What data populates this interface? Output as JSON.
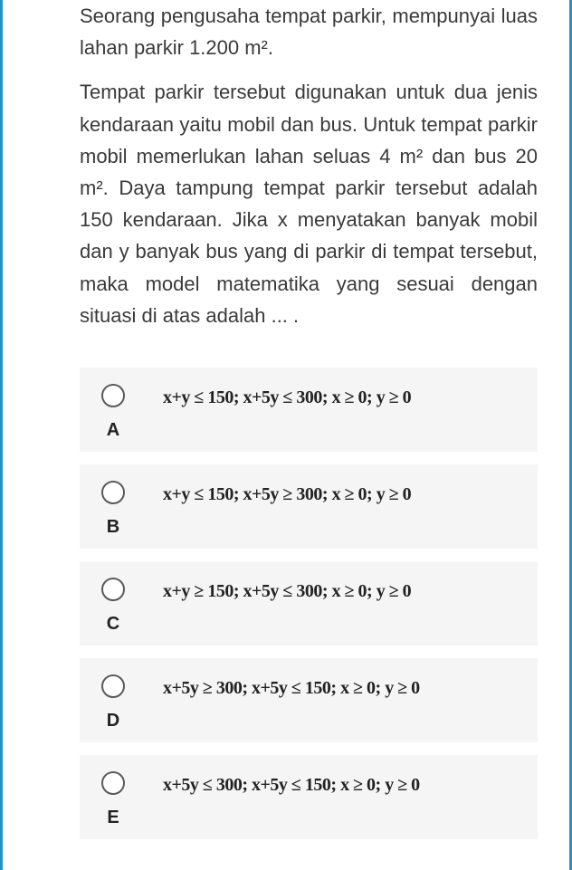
{
  "question": {
    "paragraph1": "Seorang pengusaha tempat parkir, mempunyai luas lahan parkir 1.200 m².",
    "paragraph2": "Tempat parkir tersebut digunakan untuk dua jenis kendaraan yaitu mobil dan bus. Untuk tempat parkir mobil memerlukan lahan seluas 4 m² dan bus 20 m². Daya tampung tempat parkir tersebut adalah 150 kendaraan. Jika x menyatakan banyak mobil dan y banyak bus yang di parkir di tempat tersebut, maka model matematika yang sesuai dengan situasi di atas adalah ... ."
  },
  "options": [
    {
      "label": "A",
      "expression": "x+y ≤ 150; x+5y ≤ 300; x ≥ 0; y ≥ 0"
    },
    {
      "label": "B",
      "expression": "x+y ≤ 150; x+5y ≥ 300; x ≥ 0; y ≥ 0"
    },
    {
      "label": "C",
      "expression": "x+y ≥ 150; x+5y ≤ 300; x ≥ 0; y ≥ 0"
    },
    {
      "label": "D",
      "expression": "x+5y ≥ 300; x+5y ≤ 150; x ≥ 0; y ≥ 0"
    },
    {
      "label": "E",
      "expression": "x+5y ≤ 300; x+5y ≤ 150; x ≥ 0; y ≥ 0"
    }
  ]
}
